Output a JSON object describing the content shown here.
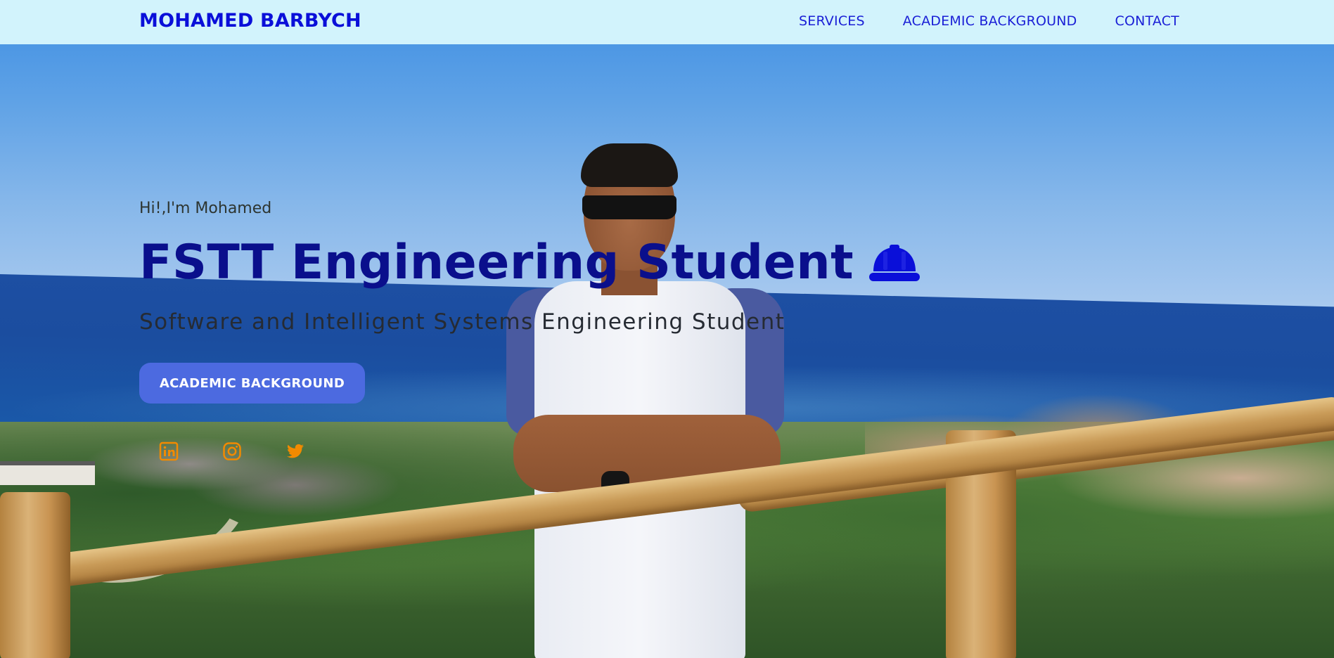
{
  "header": {
    "brand": "MOHAMED BARBYCH",
    "nav": [
      {
        "label": "SERVICES"
      },
      {
        "label": "ACADEMIC BACKGROUND"
      },
      {
        "label": "CONTACT"
      }
    ]
  },
  "hero": {
    "greeting": "Hi!,I'm Mohamed",
    "headline": "FSTT Engineering Student",
    "headline_icon": "helmet-icon",
    "subtitle": "Software and Intelligent Systems Engineering Student",
    "cta_label": "ACADEMIC BACKGROUND",
    "socials": [
      {
        "icon": "linkedin-icon"
      },
      {
        "icon": "instagram-icon"
      },
      {
        "icon": "twitter-icon"
      }
    ]
  },
  "colors": {
    "nav_background": "#d2f3fc",
    "brand": "#0a0fd9",
    "headline": "#0a0f8c",
    "cta_background": "#4c6ae0",
    "social_icons": "#f28a00"
  }
}
